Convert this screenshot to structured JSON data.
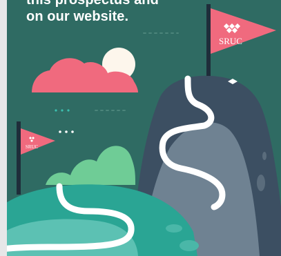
{
  "headline": {
    "line1": "this prospectus and",
    "line2": "on our website."
  },
  "flags": {
    "large_label": "SRUC",
    "small_label": "SRUC"
  },
  "colors": {
    "background": "#2f6b63",
    "cloud": "#f06a7e",
    "sun": "#fdf6ec",
    "mountain_dark": "#3c4f62",
    "mountain_light": "#6f8292",
    "hill_green": "#6fcc96",
    "foreground_teal": "#2aa594",
    "flag": "#f06a7e",
    "path": "#ffffff"
  }
}
